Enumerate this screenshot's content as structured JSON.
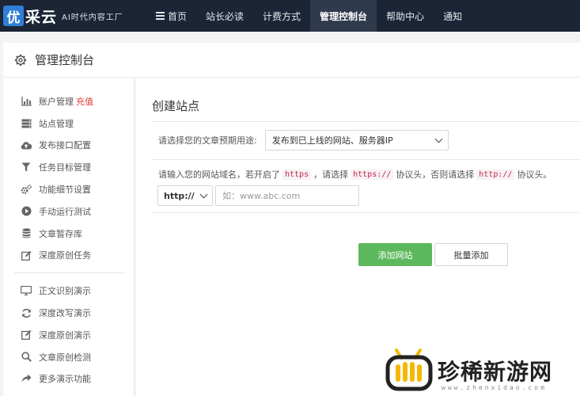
{
  "brand": {
    "mark": "优",
    "name": "采云",
    "slogan": "AI时代内容工厂"
  },
  "nav": {
    "items": [
      {
        "label": "首页",
        "active": false
      },
      {
        "label": "站长必读",
        "active": false
      },
      {
        "label": "计费方式",
        "active": false
      },
      {
        "label": "管理控制台",
        "active": true
      },
      {
        "label": "帮助中心",
        "active": false
      },
      {
        "label": "通知",
        "active": false
      }
    ]
  },
  "page": {
    "title": "管理控制台"
  },
  "sidebar": {
    "group1": [
      {
        "label": "账户管理",
        "icon": "chart-icon"
      },
      {
        "label": "站点管理",
        "icon": "server-icon"
      },
      {
        "label": "发布接口配置",
        "icon": "cloud-upload-icon"
      },
      {
        "label": "任务目标管理",
        "icon": "filter-icon"
      },
      {
        "label": "功能细节设置",
        "icon": "cogs-icon"
      },
      {
        "label": "手动运行测试",
        "icon": "play-icon"
      },
      {
        "label": "文章暂存库",
        "icon": "database-icon"
      },
      {
        "label": "深度原创任务",
        "icon": "edit-icon"
      }
    ],
    "recharge_label": "充值",
    "group2": [
      {
        "label": "正文识别演示",
        "icon": "monitor-icon"
      },
      {
        "label": "深度改写演示",
        "icon": "refresh-icon"
      },
      {
        "label": "深度原创演示",
        "icon": "edit-icon"
      },
      {
        "label": "文章原创检测",
        "icon": "search-icon"
      },
      {
        "label": "更多演示功能",
        "icon": "share-icon"
      }
    ]
  },
  "form": {
    "section_title": "创建站点",
    "purpose_label": "请选择您的文章预期用途:",
    "purpose_value": "发布到已上线的网站、服务器IP",
    "hint_part1": "请输入您的网站域名，若开启了",
    "hint_code1": "https",
    "hint_part2": "，请选择",
    "hint_code2": "https://",
    "hint_part3": "协议头，否则请选择",
    "hint_code3": "http://",
    "hint_part4": "协议头。",
    "protocol_value": "http://",
    "domain_placeholder": "如：www.abc.com",
    "add_button": "添加网站",
    "batch_button": "批量添加"
  },
  "watermark": {
    "text": "珍稀新游网",
    "url": "www.zhenxidao.com"
  },
  "colors": {
    "nav_bg": "#1b2536",
    "accent_green": "#5cb85c",
    "recharge_red": "#e23b3b"
  }
}
